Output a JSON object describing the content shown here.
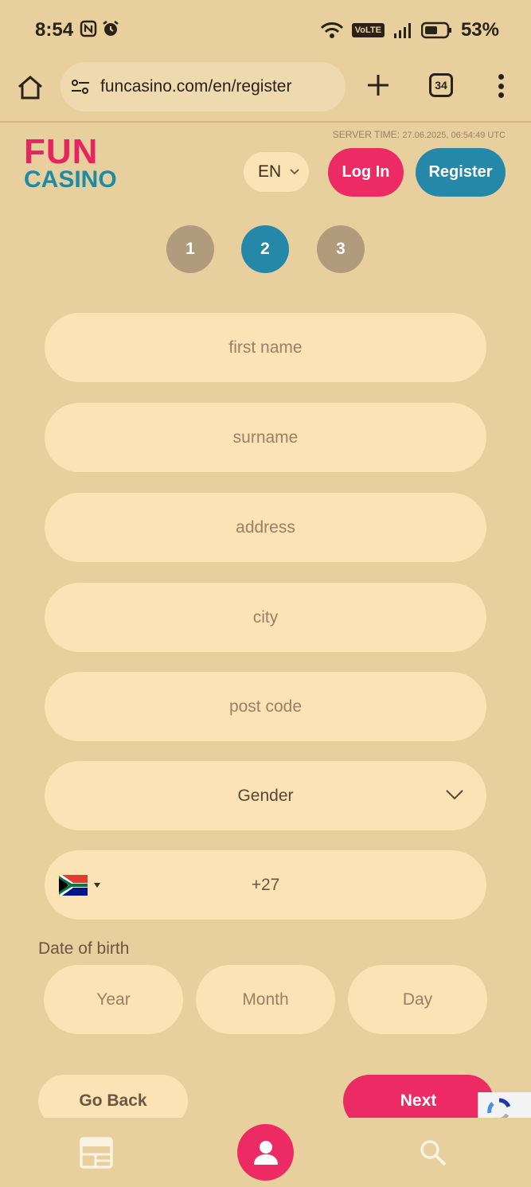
{
  "status_bar": {
    "time": "8:54",
    "battery": "53%",
    "network": "VoLTE"
  },
  "browser": {
    "url": "funcasino.com/en/register",
    "tab_count": "34"
  },
  "header": {
    "server_time_label": "SERVER TIME:",
    "server_time_value": "27.06.2025, 06:54:49 UTC",
    "logo_top": "FUN",
    "logo_bottom": "CASINO",
    "language": "EN",
    "login_label": "Log In",
    "register_label": "Register"
  },
  "steps": {
    "items": [
      "1",
      "2",
      "3"
    ],
    "active": "2"
  },
  "form": {
    "first_name_placeholder": "first name",
    "surname_placeholder": "surname",
    "address_placeholder": "address",
    "city_placeholder": "city",
    "post_code_placeholder": "post code",
    "gender_label": "Gender",
    "phone_prefix": "+27",
    "phone_country_flag": "south-africa-flag",
    "dob_label": "Date of birth",
    "dob_year": "Year",
    "dob_month": "Month",
    "dob_day": "Day",
    "back_label": "Go Back",
    "next_label": "Next"
  },
  "bottom_nav": {
    "items": [
      "calendar-icon",
      "profile-icon",
      "search-icon"
    ]
  },
  "colors": {
    "background": "#e8cf9e",
    "field": "#fbe3b6",
    "primary_pink": "#ec2a63",
    "primary_teal": "#2588a8",
    "step_inactive": "#b09b7c"
  }
}
